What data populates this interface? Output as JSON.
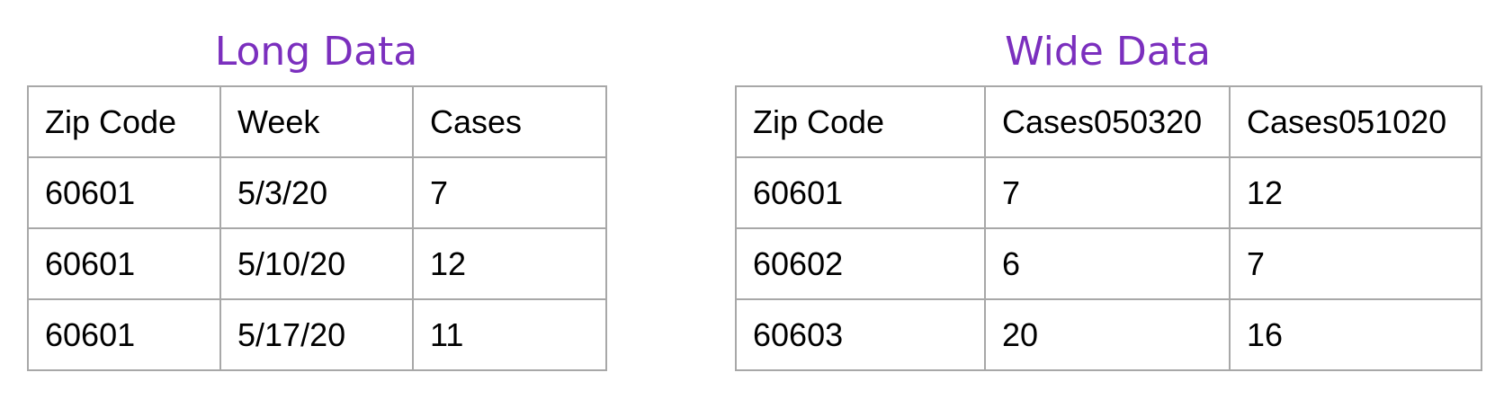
{
  "long_table": {
    "title": "Long Data",
    "headers": [
      "Zip Code",
      "Week",
      "Cases"
    ],
    "rows": [
      [
        "60601",
        "5/3/20",
        "7"
      ],
      [
        "60601",
        "5/10/20",
        "12"
      ],
      [
        "60601",
        "5/17/20",
        "11"
      ]
    ]
  },
  "wide_table": {
    "title": "Wide Data",
    "headers": [
      "Zip Code",
      "Cases050320",
      "Cases051020"
    ],
    "rows": [
      [
        "60601",
        "7",
        "12"
      ],
      [
        "60602",
        "6",
        "7"
      ],
      [
        "60603",
        "20",
        "16"
      ]
    ]
  },
  "colors": {
    "title": "#7b2fbe",
    "border": "#a8a8a8",
    "text": "#000000"
  }
}
